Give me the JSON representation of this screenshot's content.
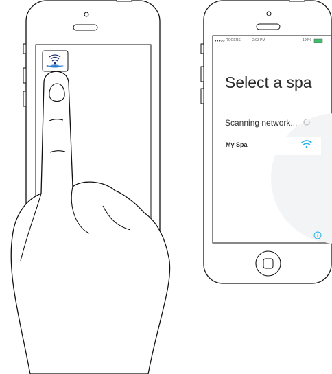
{
  "right_phone": {
    "status_bar": {
      "carrier": "ROGERS",
      "time": "2:03 PM",
      "battery": "100%"
    },
    "title": "Select a spa",
    "scanning_label": "Scanning network...",
    "spa_list": [
      {
        "name": "My Spa",
        "icon": "wifi-icon"
      }
    ],
    "info_icon": "info-icon",
    "accent_color": "#27b3e6"
  },
  "left_phone": {
    "app_icon": "spa-wifi-app-icon"
  },
  "hand": {
    "icon": "pointing-hand"
  }
}
